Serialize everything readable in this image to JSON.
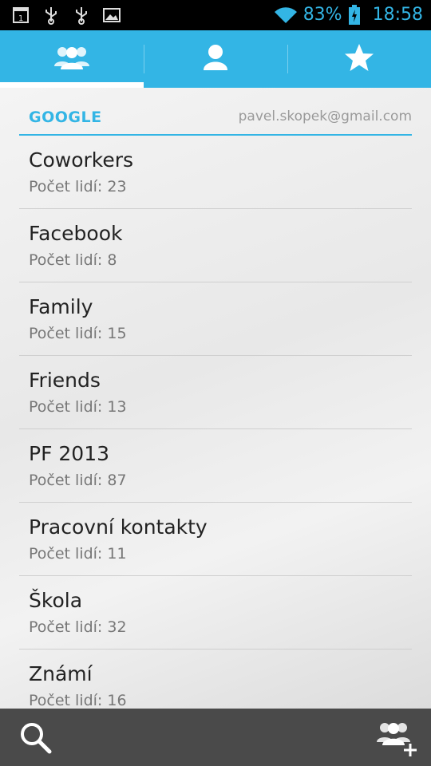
{
  "status_bar": {
    "battery_percent": "83%",
    "time": "18:58",
    "icons": [
      "sim-card-icon",
      "usb-icon",
      "usb-icon",
      "image-icon",
      "wifi-icon",
      "battery-charging-icon"
    ]
  },
  "tabs": [
    {
      "icon": "groups-icon",
      "active": true
    },
    {
      "icon": "person-icon",
      "active": false
    },
    {
      "icon": "star-icon",
      "active": false
    }
  ],
  "account": {
    "type": "GOOGLE",
    "email": "pavel.skopek@gmail.com"
  },
  "groups": [
    {
      "name": "Coworkers",
      "count": "Počet lidí: 23"
    },
    {
      "name": "Facebook",
      "count": "Počet lidí: 8"
    },
    {
      "name": "Family",
      "count": "Počet lidí: 15"
    },
    {
      "name": "Friends",
      "count": "Počet lidí: 13"
    },
    {
      "name": "PF 2013",
      "count": "Počet lidí: 87"
    },
    {
      "name": "Pracovní kontakty",
      "count": "Počet lidí: 11"
    },
    {
      "name": "Škola",
      "count": "Počet lidí: 32"
    },
    {
      "name": "Známí",
      "count": "Počet lidí: 16"
    }
  ],
  "bottom_bar": {
    "left_icon": "search-icon",
    "right_icon": "add-group-icon"
  },
  "colors": {
    "accent": "#33b5e5",
    "status_bar_bg": "#000000",
    "bottom_bar_bg": "#4a4a4a"
  }
}
